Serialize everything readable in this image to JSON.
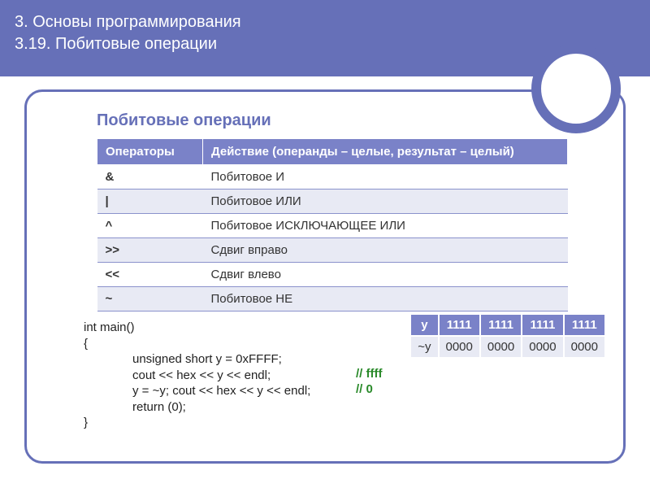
{
  "header": {
    "line1": "3. Основы программирования",
    "line2": "3.19. Побитовые операции"
  },
  "section_title": "Побитовые операции",
  "table": {
    "col1": "Операторы",
    "col2": "Действие (операнды – целые, результат – целый)",
    "rows": [
      {
        "op": "&",
        "desc": "Побитовое И"
      },
      {
        "op": "|",
        "desc": "Побитовое ИЛИ"
      },
      {
        "op": "^",
        "desc": "Побитовое ИСКЛЮЧАЮЩЕЕ ИЛИ"
      },
      {
        "op": ">>",
        "desc": "Сдвиг вправо"
      },
      {
        "op": "<<",
        "desc": "Сдвиг влево"
      },
      {
        "op": "~",
        "desc": "Побитовое НЕ"
      }
    ]
  },
  "code": {
    "l1": "int main()",
    "l2": "{",
    "l3": "unsigned short y = 0xFFFF;",
    "l4": "cout << hex << y << endl;",
    "c4": "//  ffff",
    "l5": "y = ~y; cout << hex << y << endl;",
    "c5": "//  0",
    "l6": "return (0);",
    "l7": "}"
  },
  "bits": {
    "h0": "y",
    "h1": "1111",
    "h2": "1111",
    "h3": "1111",
    "h4": "1111",
    "r0": "~y",
    "r1": "0000",
    "r2": "0000",
    "r3": "0000",
    "r4": "0000"
  }
}
